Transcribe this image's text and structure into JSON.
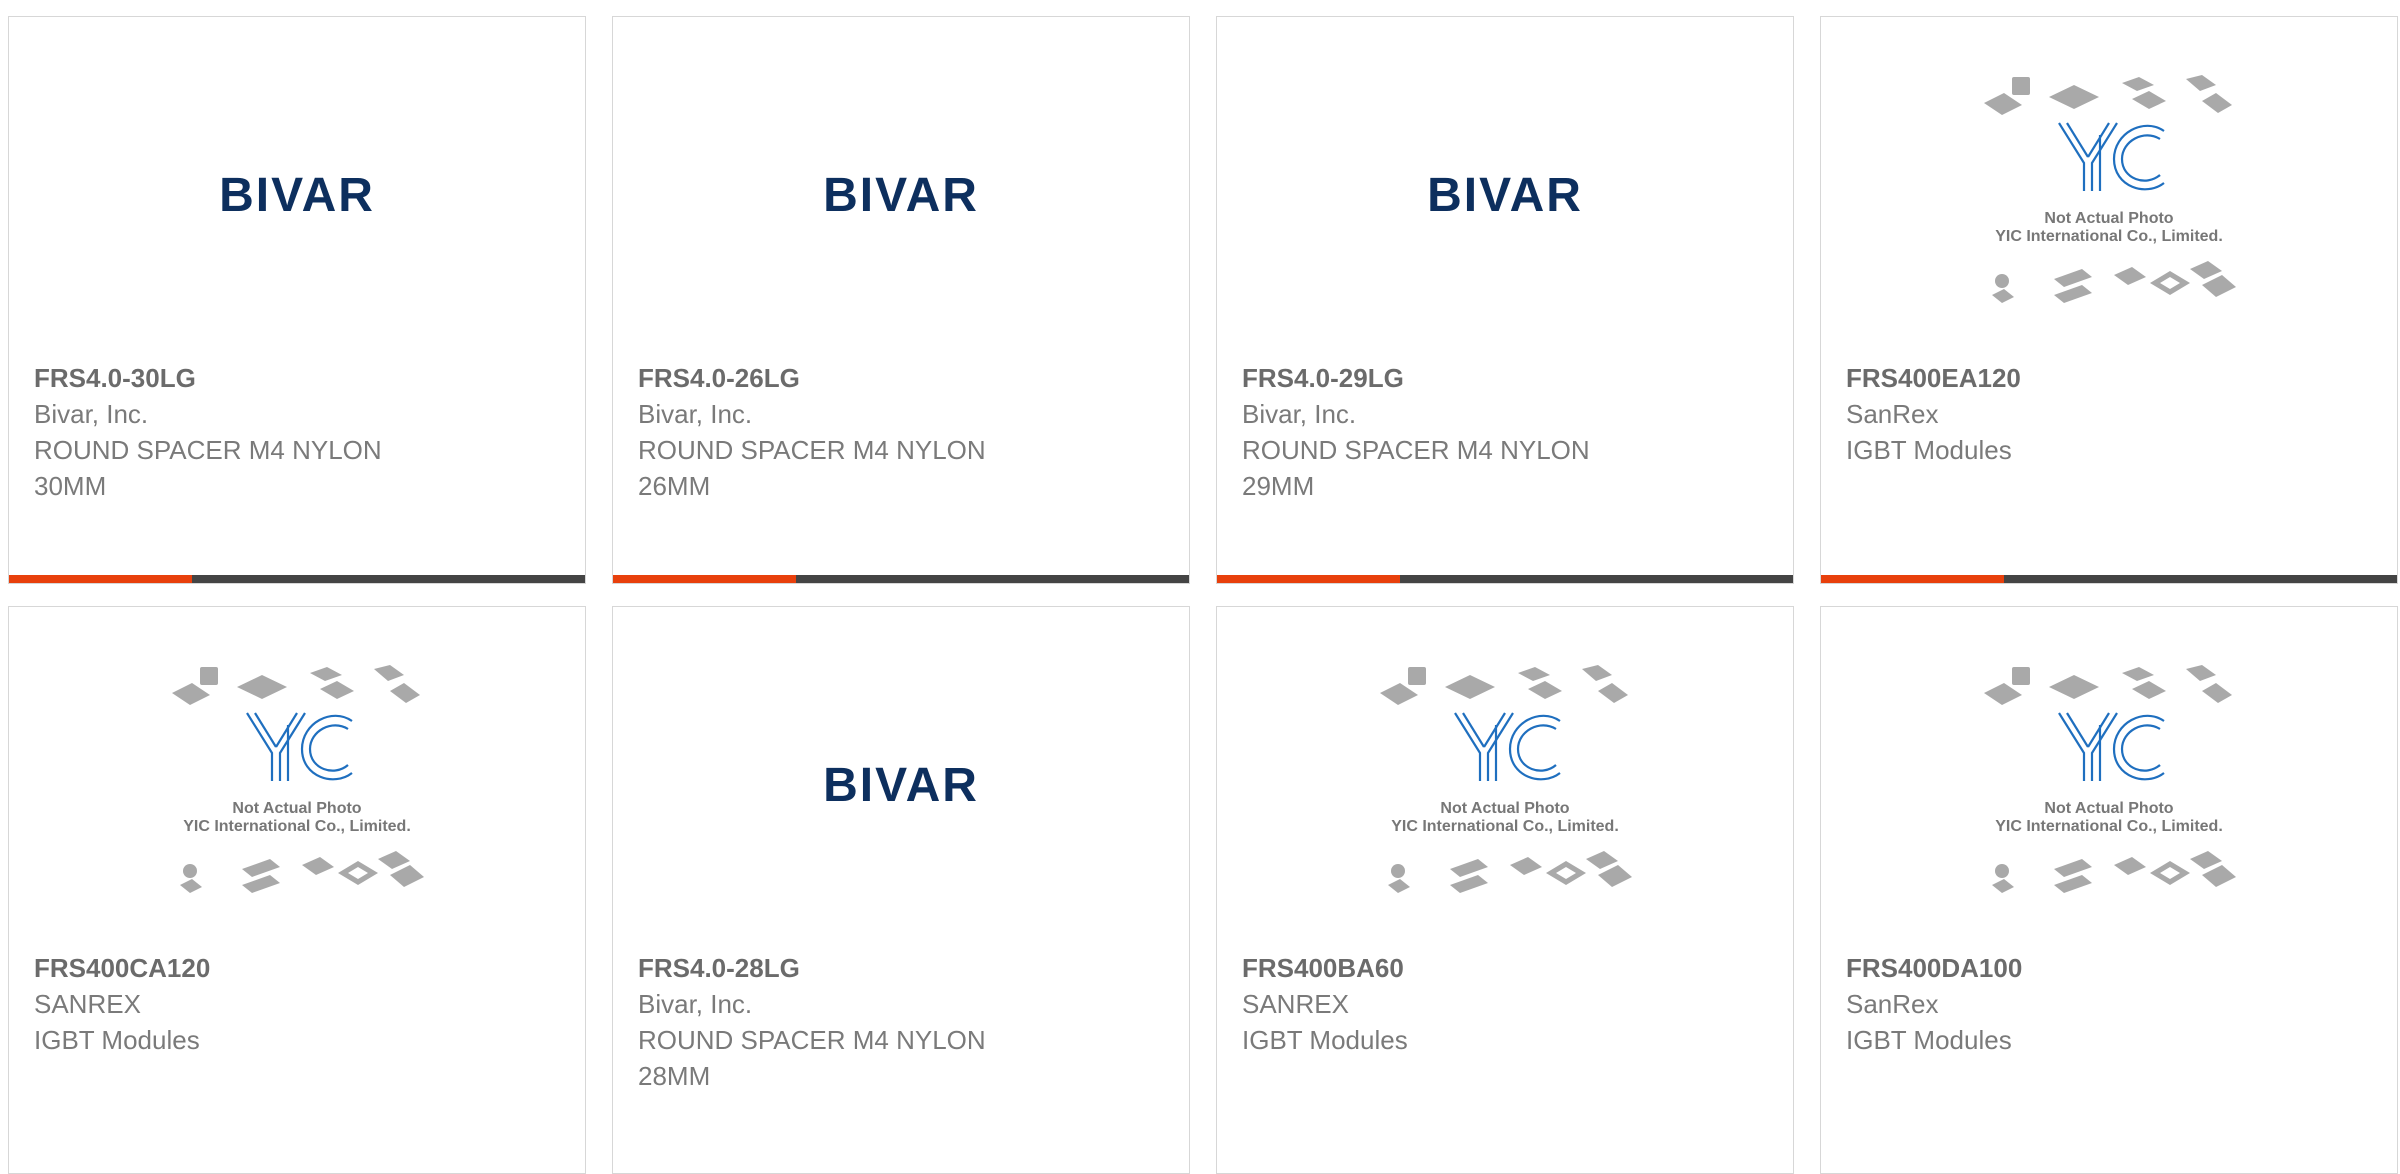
{
  "colors": {
    "accent": "#e8400c",
    "bar_dark": "#444444",
    "bivar_navy": "#0d2f5e",
    "yic_blue": "#1f6fbf"
  },
  "logos": {
    "bivar_text": "BIVAR",
    "yic_caption_line1": "Not Actual Photo",
    "yic_caption_line2": "YIC International Co., Limited."
  },
  "products": [
    {
      "part_number": "FRS4.0-30LG",
      "manufacturer": "Bivar, Inc.",
      "description": "ROUND SPACER M4 NYLON 30MM",
      "image": "bivar-logo"
    },
    {
      "part_number": "FRS4.0-26LG",
      "manufacturer": "Bivar, Inc.",
      "description": "ROUND SPACER M4 NYLON 26MM",
      "image": "bivar-logo"
    },
    {
      "part_number": "FRS4.0-29LG",
      "manufacturer": "Bivar, Inc.",
      "description": "ROUND SPACER M4 NYLON 29MM",
      "image": "bivar-logo"
    },
    {
      "part_number": "FRS400EA120",
      "manufacturer": "SanRex",
      "description": "IGBT Modules",
      "image": "yic-placeholder"
    },
    {
      "part_number": "FRS400CA120",
      "manufacturer": "SANREX",
      "description": "IGBT Modules",
      "image": "yic-placeholder"
    },
    {
      "part_number": "FRS4.0-28LG",
      "manufacturer": "Bivar, Inc.",
      "description": "ROUND SPACER M4 NYLON 28MM",
      "image": "bivar-logo"
    },
    {
      "part_number": "FRS400BA60",
      "manufacturer": "SANREX",
      "description": "IGBT Modules",
      "image": "yic-placeholder"
    },
    {
      "part_number": "FRS400DA100",
      "manufacturer": "SanRex",
      "description": "IGBT Modules",
      "image": "yic-placeholder"
    }
  ]
}
